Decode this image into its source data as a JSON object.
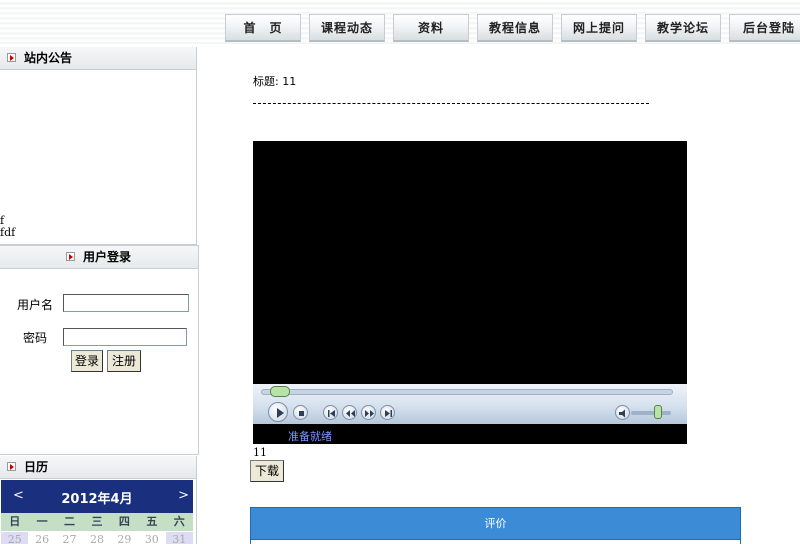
{
  "nav": {
    "items": [
      "首　页",
      "课程动态",
      "资料",
      "教程信息",
      "网上提问",
      "教学论坛",
      "后台登陆"
    ]
  },
  "notice": {
    "title": "站内公告",
    "lines": [
      "df",
      "dfdf"
    ]
  },
  "login": {
    "title": "用户登录",
    "username_label": "用户名",
    "password_label": "密码",
    "username_value": "",
    "password_value": "",
    "login_button": "登录",
    "register_button": "注册"
  },
  "calendar": {
    "title": "日历",
    "prev": "<",
    "next": ">",
    "month": "2012年4月",
    "weekdays": [
      "日",
      "一",
      "二",
      "三",
      "四",
      "五",
      "六"
    ],
    "days": [
      "25",
      "26",
      "27",
      "28",
      "29",
      "30",
      "31"
    ]
  },
  "content": {
    "title": "标题: 11",
    "caption": "11",
    "download_button": "下载",
    "evaluation_header": "评价"
  },
  "player": {
    "status": "准备就绪",
    "progress": 0.02,
    "volume": 0.6,
    "controls": [
      "play-icon",
      "stop-icon",
      "previous-icon",
      "rewind-icon",
      "fast-forward-icon",
      "next-icon",
      "volume-icon"
    ]
  },
  "colors": {
    "calendar_header": "#1a2f7e",
    "calendar_weekdays": "#c4dfc6",
    "evaluation_header": "#3c8bd7",
    "player_status": "#7b95ff"
  }
}
